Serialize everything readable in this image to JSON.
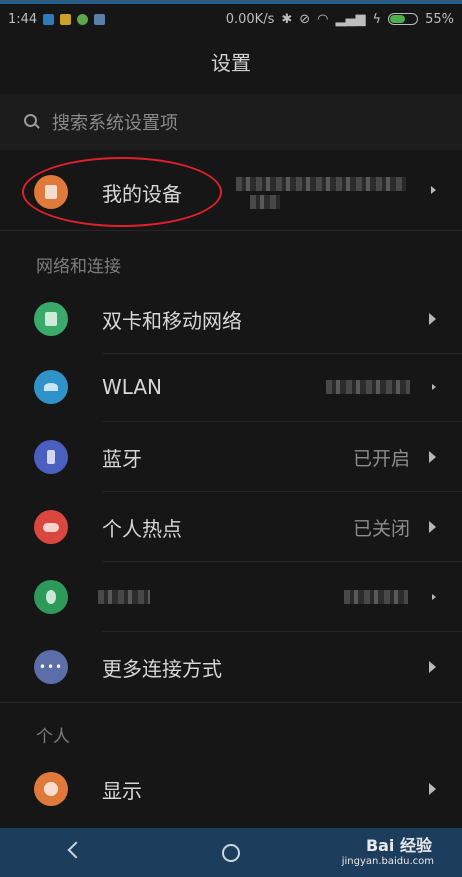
{
  "status_bar": {
    "time": "1:44",
    "net_speed": "0.00K/s",
    "battery": "55%",
    "battery_level": 0.55
  },
  "header": {
    "title": "设置"
  },
  "search": {
    "placeholder": "搜索系统设置项"
  },
  "my_device": {
    "label": "我的设备",
    "icon": "device-icon",
    "icon_color": "#e07a3a"
  },
  "sections": {
    "network": "网络和连接",
    "personal": "个人"
  },
  "network_items": [
    {
      "label": "双卡和移动网络",
      "value": "",
      "icon": "sim-icon",
      "color": "#3aaa6b"
    },
    {
      "label": "WLAN",
      "value": "",
      "icon": "wifi-icon",
      "color": "#2f93c9"
    },
    {
      "label": "蓝牙",
      "value": "已开启",
      "icon": "bluetooth-icon",
      "color": "#4a5fc0"
    },
    {
      "label": "个人热点",
      "value": "已关闭",
      "icon": "hotspot-icon",
      "color": "#d9473f"
    },
    {
      "label": "",
      "value": "",
      "icon": "vpn-icon",
      "color": "#2d9a5a"
    },
    {
      "label": "更多连接方式",
      "value": "",
      "icon": "more-icon",
      "color": "#5b6ea8"
    }
  ],
  "personal_items": [
    {
      "label": "显示",
      "icon": "display-icon",
      "color": "#e07a3a"
    }
  ],
  "watermark": {
    "brand": "Bai 经验",
    "url": "jingyan.baidu.com"
  }
}
